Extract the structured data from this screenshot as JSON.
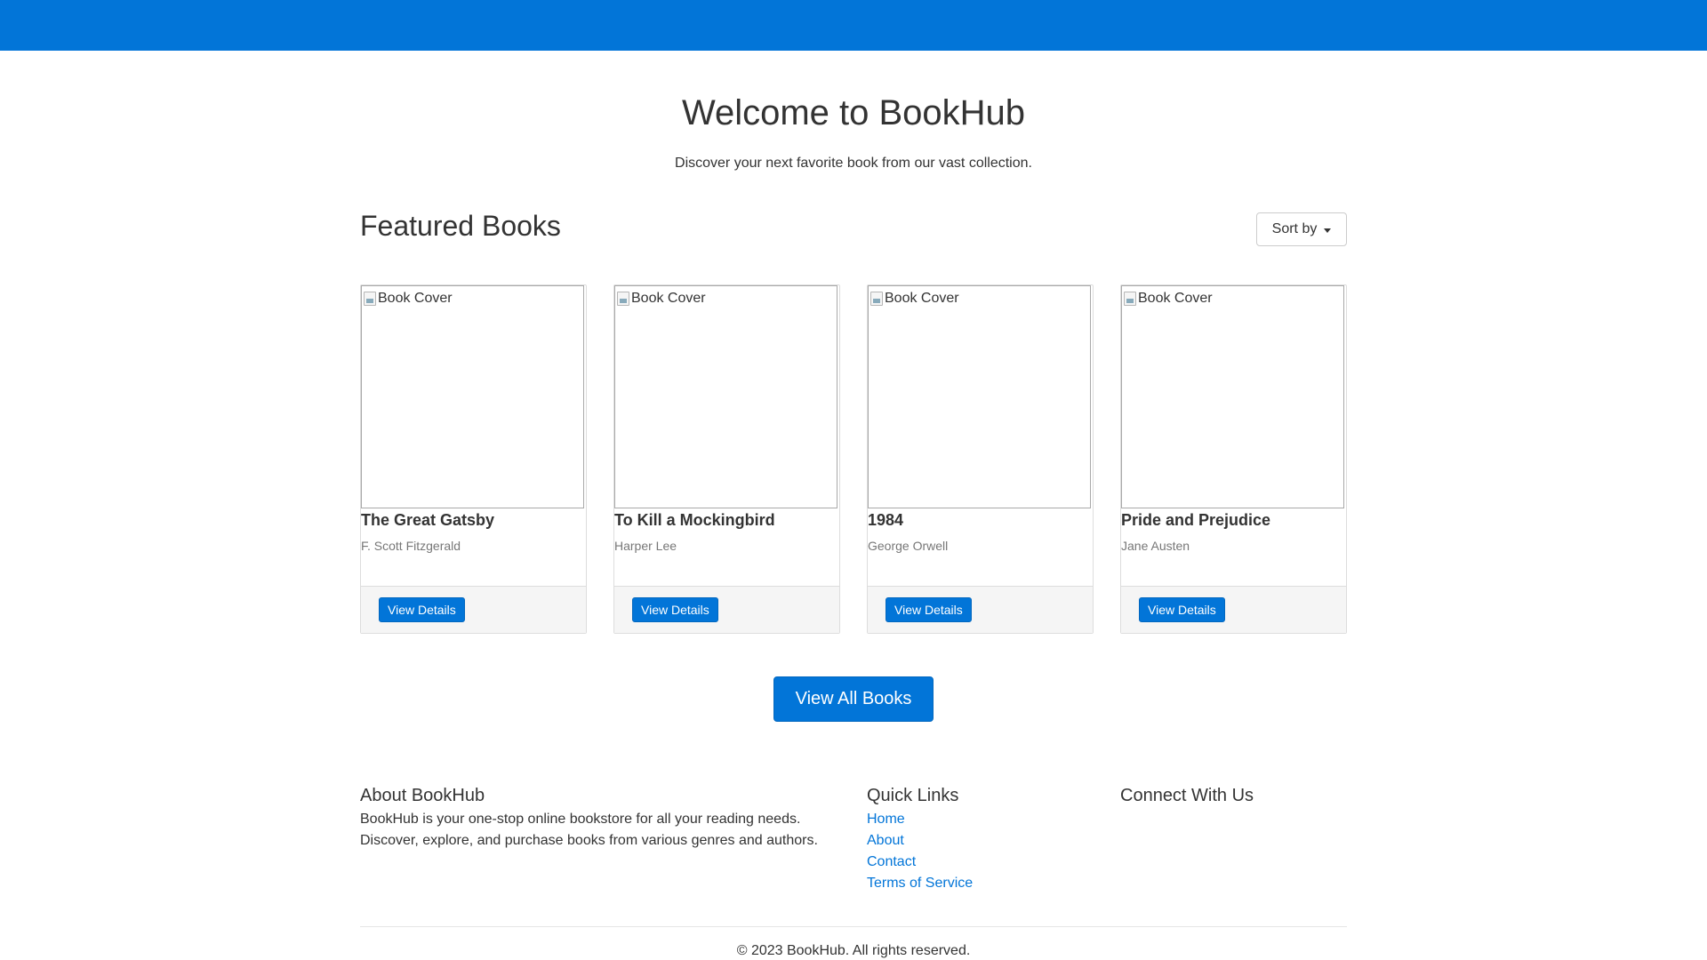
{
  "header": {
    "brand_color": "#0275d8"
  },
  "hero": {
    "title": "Welcome to BookHub",
    "subtitle": "Discover your next favorite book from our vast collection."
  },
  "featured": {
    "title": "Featured Books",
    "sort_label": "Sort by"
  },
  "books": [
    {
      "cover_alt": "Book Cover",
      "title": "The Great Gatsby",
      "author": "F. Scott Fitzgerald",
      "button": "View Details"
    },
    {
      "cover_alt": "Book Cover",
      "title": "To Kill a Mockingbird",
      "author": "Harper Lee",
      "button": "View Details"
    },
    {
      "cover_alt": "Book Cover",
      "title": "1984",
      "author": "George Orwell",
      "button": "View Details"
    },
    {
      "cover_alt": "Book Cover",
      "title": "Pride and Prejudice",
      "author": "Jane Austen",
      "button": "View Details"
    }
  ],
  "view_all_label": "View All Books",
  "footer": {
    "about": {
      "title": "About BookHub",
      "text_line1": "BookHub is your one-stop online bookstore for all your reading needs.",
      "text_line2": "Discover, explore, and purchase books from various genres and authors."
    },
    "quick_links": {
      "title": "Quick Links",
      "items": [
        "Home",
        "About",
        "Contact",
        "Terms of Service"
      ]
    },
    "connect": {
      "title": "Connect With Us"
    },
    "copyright": "© 2023 BookHub. All rights reserved."
  }
}
